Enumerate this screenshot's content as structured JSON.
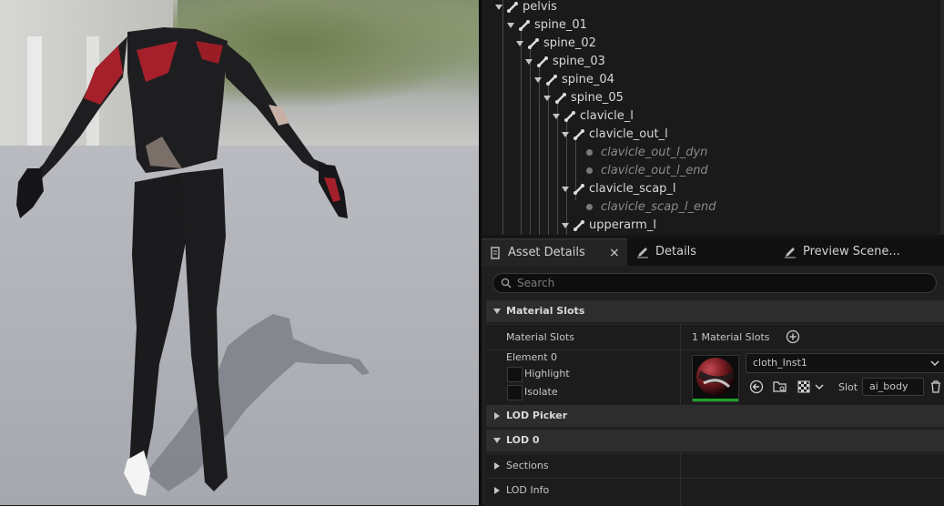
{
  "skeleton_tree": {
    "rows": [
      {
        "label": "pelvis",
        "kind": "bone"
      },
      {
        "label": "spine_01",
        "kind": "bone"
      },
      {
        "label": "spine_02",
        "kind": "bone"
      },
      {
        "label": "spine_03",
        "kind": "bone"
      },
      {
        "label": "spine_04",
        "kind": "bone"
      },
      {
        "label": "spine_05",
        "kind": "bone"
      },
      {
        "label": "clavicle_l",
        "kind": "bone"
      },
      {
        "label": "clavicle_out_l",
        "kind": "bone"
      },
      {
        "label": "clavicle_out_l_dyn",
        "kind": "virtual"
      },
      {
        "label": "clavicle_out_l_end",
        "kind": "virtual"
      },
      {
        "label": "clavicle_scap_l",
        "kind": "bone"
      },
      {
        "label": "clavicle_scap_l_end",
        "kind": "virtual"
      },
      {
        "label": "upperarm_l",
        "kind": "bone"
      }
    ]
  },
  "tabs": {
    "asset_details": "Asset Details",
    "close_symbol": "×",
    "details": "Details",
    "preview_scene": "Preview Scene..."
  },
  "search": {
    "placeholder": "Search"
  },
  "material_slots_section": {
    "header": "Material Slots",
    "row_label": "Material Slots",
    "count": "1 Material Slots",
    "element_label": "Element 0",
    "highlight_label": "Highlight",
    "isolate_label": "Isolate",
    "material_value": "cloth_Inst1",
    "slot_label": "Slot",
    "slot_value": "ai_body"
  },
  "categories": {
    "lod_picker": "LOD Picker",
    "lod_0": "LOD 0",
    "sections": "Sections",
    "lod_info": "LOD Info"
  },
  "colors": {
    "accent_green": "#1fa32a",
    "suit_black": "#1b1b1d",
    "suit_red": "#a5202a"
  }
}
